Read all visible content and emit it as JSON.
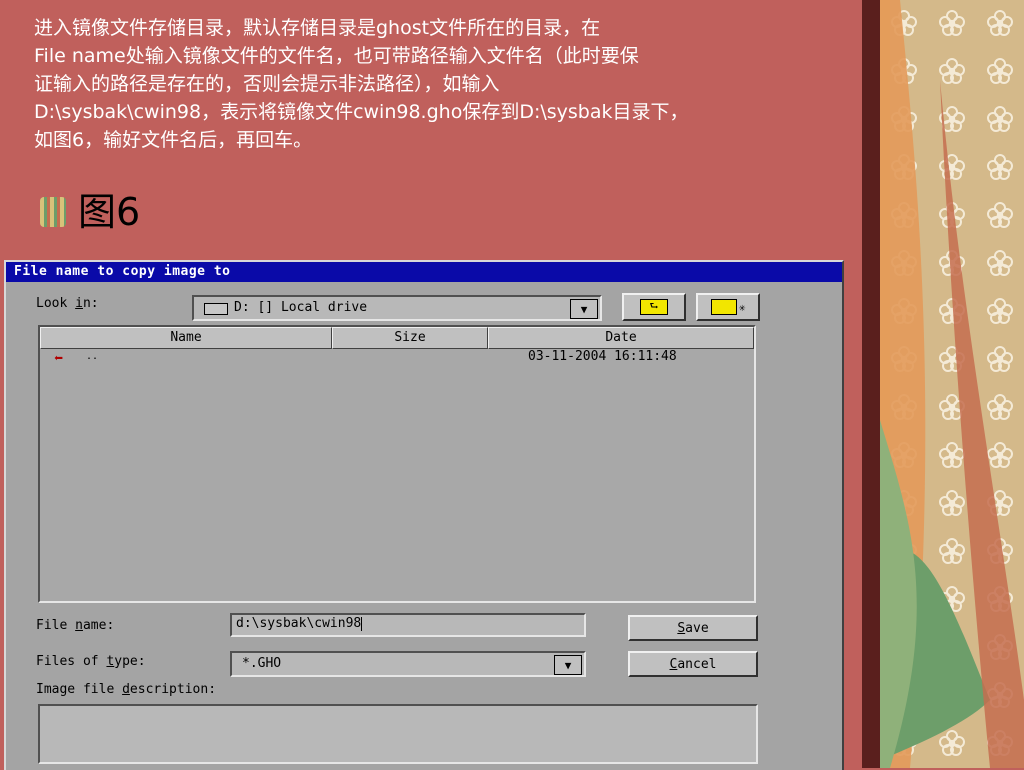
{
  "slide": {
    "lines": [
      " 进入镜像文件存储目录，默认存储目录是ghost文件所在的目录，在",
      "File name处输入镜像文件的文件名，也可带路径输入文件名（此时要保",
      "证输入的路径是存在的，否则会提示非法路径），如输入",
      "D:\\sysbak\\cwin98，表示将镜像文件cwin98.gho保存到D:\\sysbak目录下，",
      "如图6，输好文件名后，再回车。"
    ],
    "figure_label": "图6"
  },
  "dialog": {
    "title": "File name to copy image to",
    "look_in_prefix": "Look ",
    "look_in_accel": "i",
    "look_in_suffix": "n:",
    "look_in_value": "D: [] Local drive",
    "columns": [
      "Name",
      "Size",
      "Date"
    ],
    "rows": [
      {
        "name": "..",
        "size": "",
        "date": "03-11-2004 16:11:48"
      }
    ],
    "file_name_prefix": "File ",
    "file_name_accel": "n",
    "file_name_suffix": "ame:",
    "file_name_value": "d:\\sysbak\\cwin98",
    "files_of_type_prefix": "Files of ",
    "files_of_type_accel": "t",
    "files_of_type_suffix": "ype:",
    "files_of_type_value": "*.GHO",
    "image_desc_prefix": "Image file ",
    "image_desc_accel": "d",
    "image_desc_suffix": "escription:",
    "image_desc_value": "",
    "save_accel": "S",
    "save_rest": "ave",
    "cancel_accel": "C",
    "cancel_rest": "ancel"
  },
  "colors": {
    "slide_bg": "#c0605c",
    "titlebar": "#0a0aa8",
    "dialog_bg": "#a4a4a4"
  }
}
